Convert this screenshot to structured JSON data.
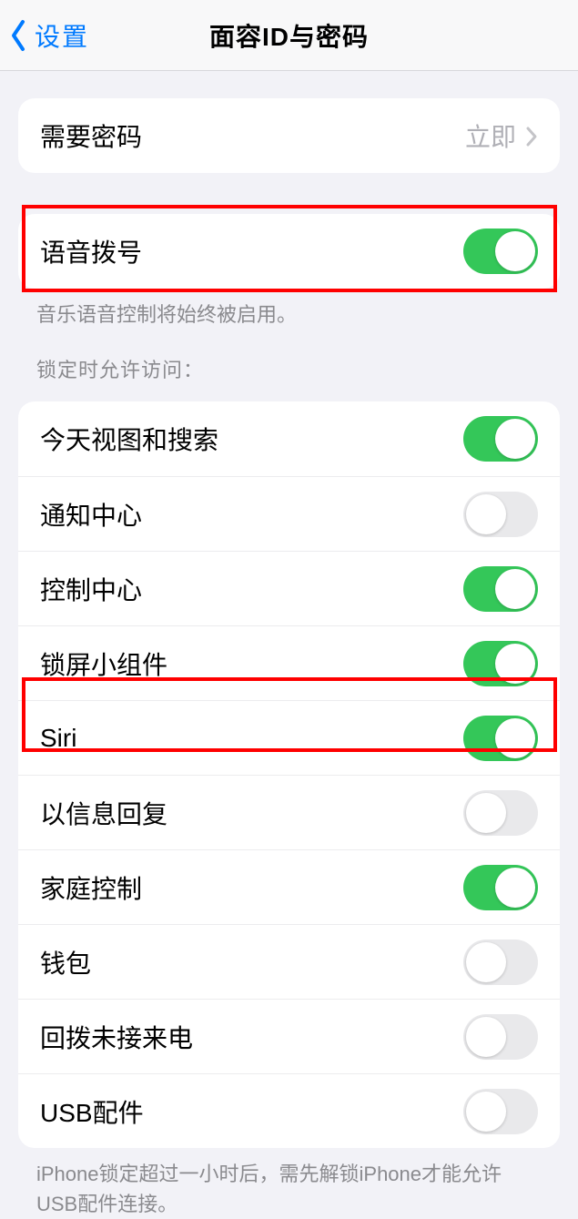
{
  "header": {
    "back_label": "设置",
    "title": "面容ID与密码"
  },
  "passcode_row": {
    "label": "需要密码",
    "value": "立即"
  },
  "voice_dial": {
    "label": "语音拨号",
    "on": true,
    "footer": "音乐语音控制将始终被启用。"
  },
  "locked_access": {
    "heading": "锁定时允许访问：",
    "items": [
      {
        "label": "今天视图和搜索",
        "on": true
      },
      {
        "label": "通知中心",
        "on": false
      },
      {
        "label": "控制中心",
        "on": true
      },
      {
        "label": "锁屏小组件",
        "on": true
      },
      {
        "label": "Siri",
        "on": true
      },
      {
        "label": "以信息回复",
        "on": false
      },
      {
        "label": "家庭控制",
        "on": true
      },
      {
        "label": "钱包",
        "on": false
      },
      {
        "label": "回拨未接来电",
        "on": false
      },
      {
        "label": "USB配件",
        "on": false
      }
    ],
    "footer": "iPhone锁定超过一小时后，需先解锁iPhone才能允许USB配件连接。"
  }
}
